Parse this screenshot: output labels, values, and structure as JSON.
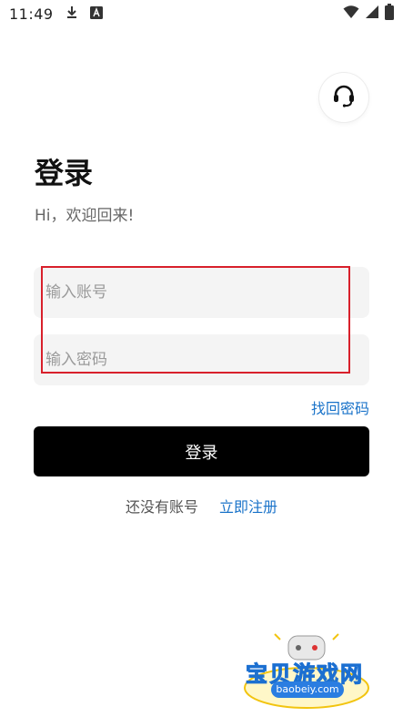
{
  "status_bar": {
    "time": "11:49"
  },
  "header": {
    "title": "登录",
    "subtitle": "Hi，欢迎回来!"
  },
  "form": {
    "account_placeholder": "输入账号",
    "account_value": "",
    "password_placeholder": "输入密码",
    "password_value": "",
    "forgot_label": "找回密码",
    "login_label": "登录"
  },
  "register": {
    "prompt": "还没有账号",
    "link": "立即注册"
  },
  "watermark": {
    "name": "宝贝游戏网",
    "url": "baobeiy.com"
  },
  "icons": {
    "support": "headset-icon",
    "download": "download-icon",
    "a_badge": "a-badge-icon",
    "wifi": "wifi-icon",
    "signal": "signal-icon",
    "battery": "battery-icon"
  },
  "colors": {
    "accent_link": "#1a73c9",
    "button_bg": "#000000",
    "field_bg": "#f4f4f4",
    "highlight": "#d8202b"
  }
}
